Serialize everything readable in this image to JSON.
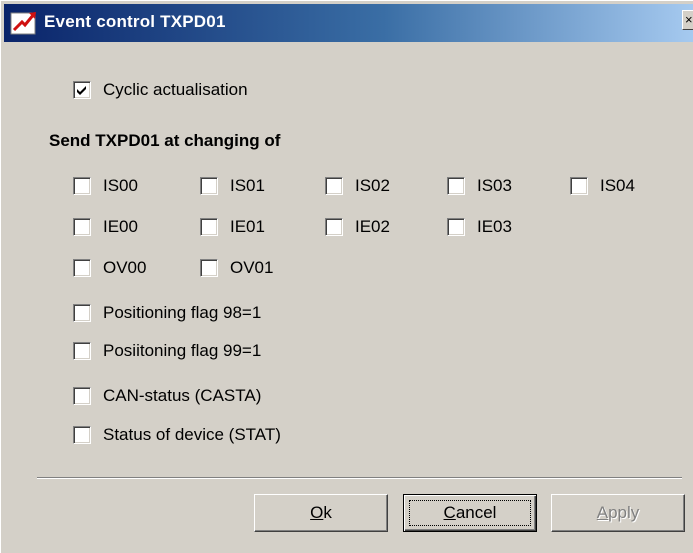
{
  "window": {
    "title": "Event control TXPD01",
    "close_glyph": "×"
  },
  "cyclic": {
    "label": "Cyclic actualisation",
    "checked": true
  },
  "section": {
    "label": "Send TXPD01 at changing of"
  },
  "signals": [
    {
      "label": "IS00",
      "checked": false
    },
    {
      "label": "IS01",
      "checked": false
    },
    {
      "label": "IS02",
      "checked": false
    },
    {
      "label": "IS03",
      "checked": false
    },
    {
      "label": "IS04",
      "checked": false
    },
    {
      "label": "IE00",
      "checked": false
    },
    {
      "label": "IE01",
      "checked": false
    },
    {
      "label": "IE02",
      "checked": false
    },
    {
      "label": "IE03",
      "checked": false
    },
    {
      "label": "OV00",
      "checked": false
    },
    {
      "label": "OV01",
      "checked": false
    }
  ],
  "flags": [
    {
      "label": "Positioning flag 98=1",
      "checked": false
    },
    {
      "label": "Posiitoning flag 99=1",
      "checked": false
    },
    {
      "label": "CAN-status (CASTA)",
      "checked": false
    },
    {
      "label": "Status of device (STAT)",
      "checked": false
    }
  ],
  "buttons": {
    "ok": {
      "mnemonic": "O",
      "rest": "k"
    },
    "cancel": {
      "mnemonic": "C",
      "rest": "ancel"
    },
    "apply": {
      "mnemonic": "A",
      "rest": "pply",
      "disabled": true
    }
  },
  "colors": {
    "dialog_bg": "#d4d0c8",
    "title_start": "#0a246a",
    "title_end": "#a6caf0"
  }
}
